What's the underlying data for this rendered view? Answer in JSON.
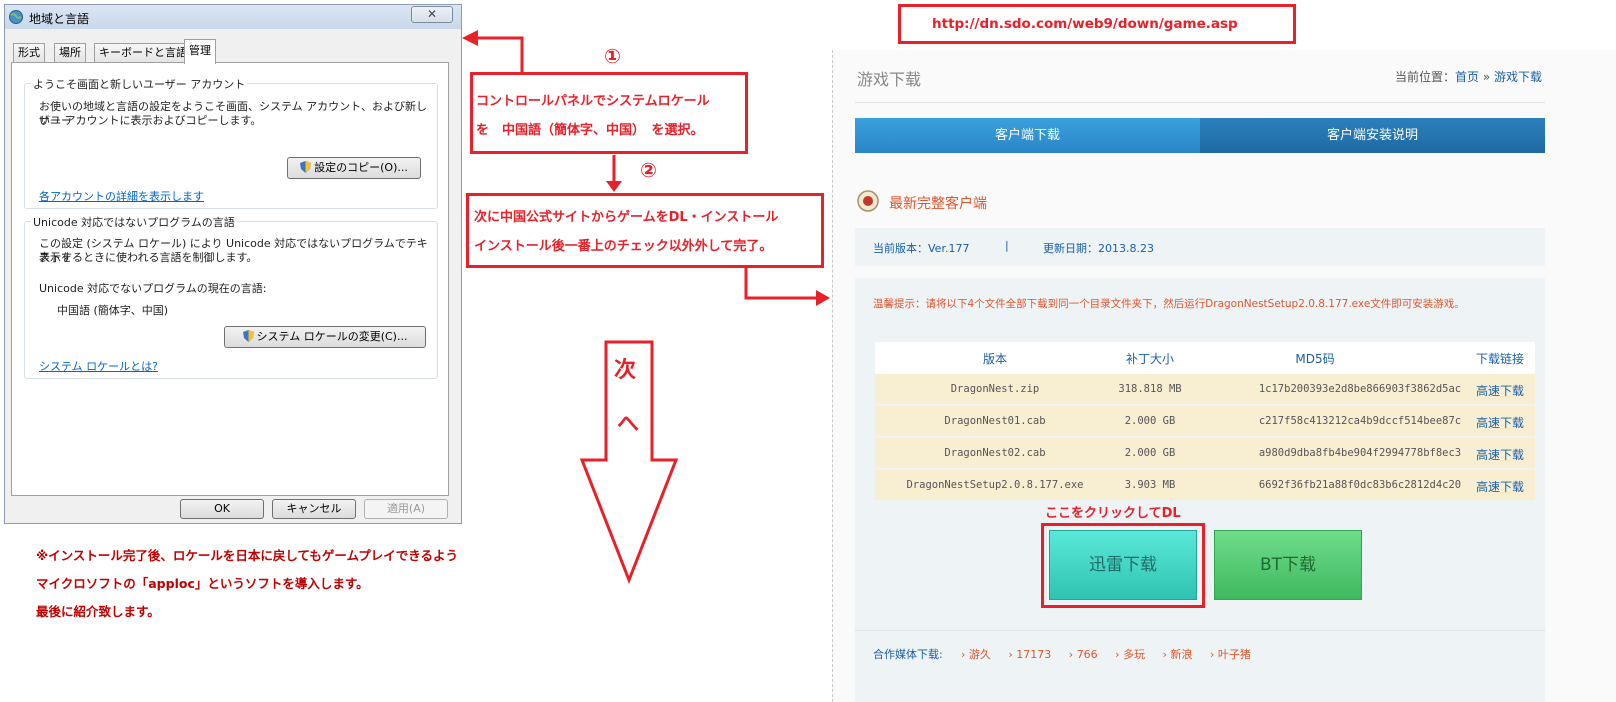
{
  "dialog": {
    "title": "地域と言語",
    "close": "✕",
    "tabs": [
      "形式",
      "場所",
      "キーボードと言語",
      "管理"
    ],
    "group1": {
      "legend": "ようこそ画面と新しいユーザー アカウント",
      "text_line1": "お使いの地域と言語の設定をようこそ画面、システム アカウント、および新しいユー",
      "text_line2": "ザー アカウントに表示およびコピーします。",
      "copy_button": "設定のコピー(O)...",
      "link": "各アカウントの詳細を表示します"
    },
    "group2": {
      "legend": "Unicode 対応ではないプログラムの言語",
      "text_line1": "この設定 (システム ロケール) により Unicode 対応ではないプログラムでテキストを",
      "text_line2": "表示するときに使われる言語を制御します。",
      "current_label": "Unicode 対応でないプログラムの現在の言語:",
      "current_value": "中国語 (簡体字、中国)",
      "change_button": "システム ロケールの変更(C)...",
      "link": "システム ロケールとは?"
    },
    "ok": "OK",
    "cancel": "キャンセル",
    "apply": "適用(A)"
  },
  "annotations": {
    "url": "http://dn.sdo.com/web9/down/game.asp",
    "step1_num": "①",
    "step1_line1": "コントロールパネルでシステムロケール",
    "step1_line2": "を　中国語（簡体字、中国）　を選択。",
    "step2_num": "②",
    "step2_line1": "次に中国公式サイトからゲームをDL・インストール",
    "step2_line2": "インストール後一番上のチェック以外外して完了。",
    "next_char1": "次",
    "next_char2": "へ",
    "click_here": "ここをクリックしてDL",
    "note_line1": "※インストール完了後、ロケールを日本に戻してもゲームプレイできるよう",
    "note_line2": "マイクロソフトの「apploc」というソフトを導入します。",
    "note_line3": "最後に紹介致します。"
  },
  "web": {
    "page_title": "游戏下载",
    "breadcrumb_label": "当前位置：",
    "breadcrumb_home": "首页",
    "breadcrumb_sep": "»",
    "breadcrumb_current": "游戏下载",
    "tab_active": "客户端下载",
    "tab_other": "客户端安装说明",
    "section_title": "最新完整客户端",
    "version_label": "当前版本：Ver.177",
    "divider": "|",
    "update_label": "更新日期：2013.8.23",
    "tip": "温馨提示：请将以下4个文件全部下载到同一个目录文件夹下，然后运行DragonNestSetup2.0.8.177.exe文件即可安装游戏。",
    "table": {
      "headers": [
        "版本",
        "补丁大小",
        "MD5码",
        "下载链接"
      ],
      "rows": [
        [
          "DragonNest.zip",
          "318.818 MB",
          "1c17b200393e2d8be866903f3862d5ac",
          "高速下载"
        ],
        [
          "DragonNest01.cab",
          "2.000 GB",
          "c217f58c413212ca4b9dccf514bee87c",
          "高速下载"
        ],
        [
          "DragonNest02.cab",
          "2.000 GB",
          "a980d9dba8fb4be904f2994778bf8ec3",
          "高速下载"
        ],
        [
          "DragonNestSetup2.0.8.177.exe",
          "3.903 MB",
          "6692f36fb21a88f0dc83b6c2812d4c20",
          "高速下载"
        ]
      ]
    },
    "btn_xunlei": "迅雷下载",
    "btn_bt": "BT下载",
    "partners_label": "合作媒体下载:",
    "partners": [
      "游久",
      "17173",
      "766",
      "多玩",
      "新浪",
      "叶子猪"
    ]
  },
  "colors": {
    "red": "#e8202a",
    "web_tab_blue": "#2a86c6",
    "xunlei": "#3fd8c8",
    "bt": "#4cc76a"
  }
}
